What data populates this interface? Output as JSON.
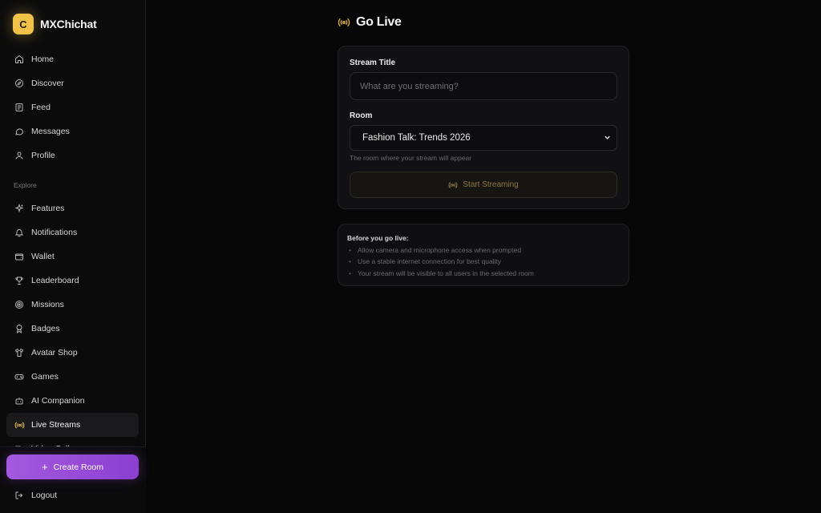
{
  "brand": {
    "logo_letter": "C",
    "name": "MXChichat"
  },
  "nav_main": [
    {
      "label": "Home",
      "icon": "home-icon"
    },
    {
      "label": "Discover",
      "icon": "compass-icon"
    },
    {
      "label": "Feed",
      "icon": "feed-icon"
    },
    {
      "label": "Messages",
      "icon": "message-icon"
    },
    {
      "label": "Profile",
      "icon": "user-icon"
    }
  ],
  "explore_label": "Explore",
  "nav_explore": [
    {
      "label": "Features",
      "icon": "sparkles-icon"
    },
    {
      "label": "Notifications",
      "icon": "bell-icon"
    },
    {
      "label": "Wallet",
      "icon": "wallet-icon"
    },
    {
      "label": "Leaderboard",
      "icon": "trophy-icon"
    },
    {
      "label": "Missions",
      "icon": "target-icon"
    },
    {
      "label": "Badges",
      "icon": "badge-icon"
    },
    {
      "label": "Avatar Shop",
      "icon": "shirt-icon"
    },
    {
      "label": "Games",
      "icon": "gamepad-icon"
    },
    {
      "label": "AI Companion",
      "icon": "bot-icon"
    },
    {
      "label": "Live Streams",
      "icon": "broadcast-icon",
      "active": true
    },
    {
      "label": "Video Calls",
      "icon": "video-icon"
    }
  ],
  "create_room_label": "Create Room",
  "logout_label": "Logout",
  "page_title": "Go Live",
  "form": {
    "stream_title_label": "Stream Title",
    "stream_title_placeholder": "What are you streaming?",
    "room_label": "Room",
    "room_selected": "Fashion Talk: Trends 2026",
    "room_hint": "The room where your stream will appear",
    "start_label": "Start Streaming"
  },
  "info": {
    "title": "Before you go live:",
    "items": [
      "Allow camera and microphone access when prompted",
      "Use a stable internet connection for best quality",
      "Your stream will be visible to all users in the selected room"
    ]
  },
  "colors": {
    "accent": "#e0b34a",
    "brand_purple": "#a459e0",
    "background": "#070707"
  }
}
